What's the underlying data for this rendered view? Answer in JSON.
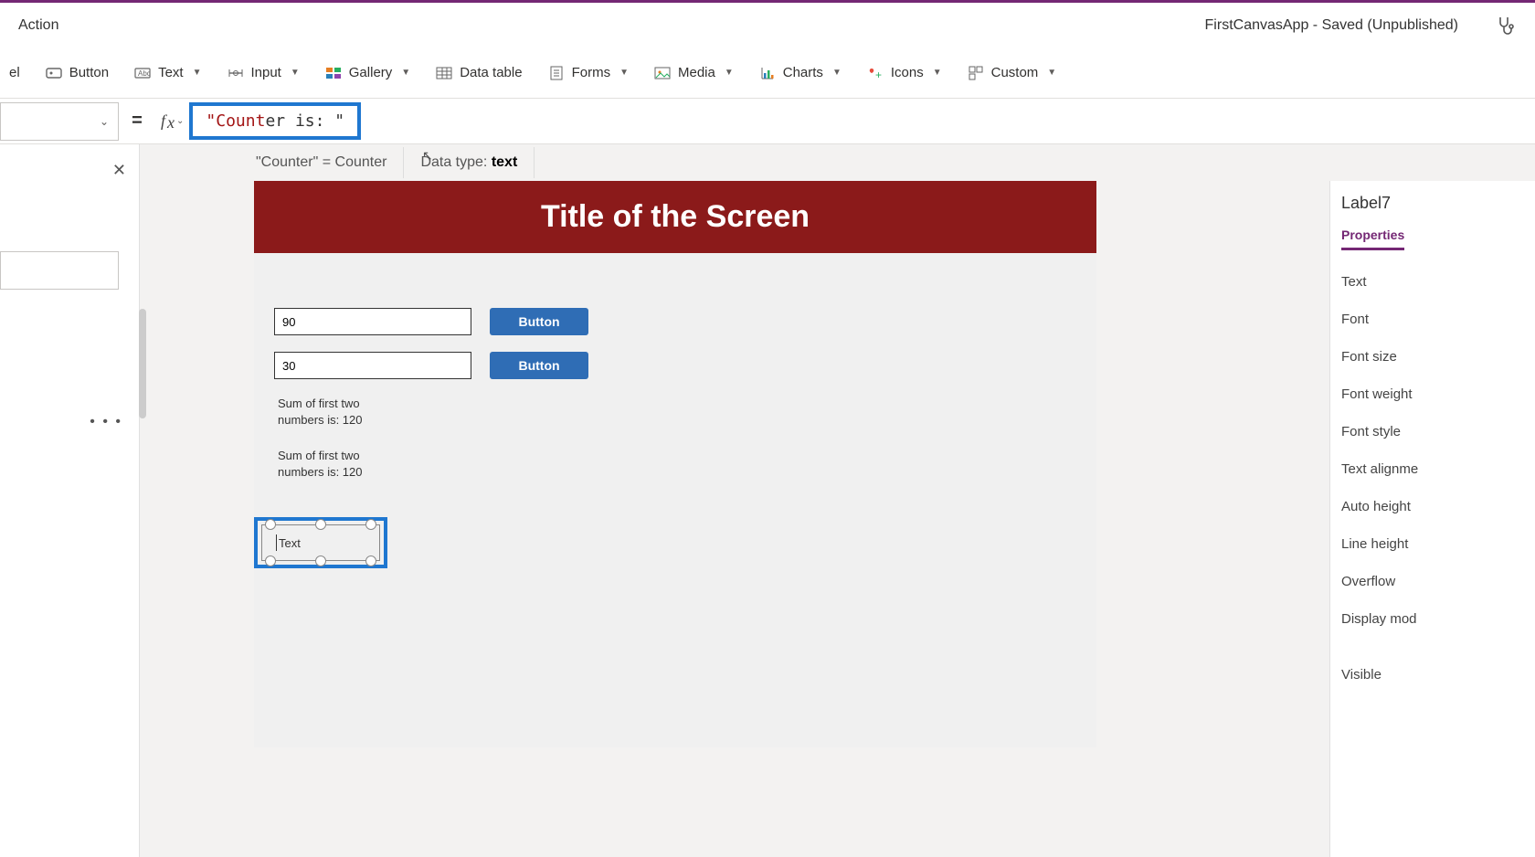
{
  "title_bar": {
    "menu_left": "Action",
    "app_title": "FirstCanvasApp - Saved (Unpublished)"
  },
  "ribbon": {
    "label_trunc": "el",
    "button": "Button",
    "text": "Text",
    "input": "Input",
    "gallery": "Gallery",
    "datatable": "Data table",
    "forms": "Forms",
    "media": "Media",
    "charts": "Charts",
    "icons": "Icons",
    "custom": "Custom"
  },
  "formula": {
    "value_quoted": "\"Counter is: \"",
    "value_highlight_prefix": "\"Count",
    "value_highlight_rest": "er is: \""
  },
  "intellisense": {
    "line": "\"Counter\"  =  Counter",
    "datatype_label": "Data type: ",
    "datatype_value": "text"
  },
  "canvas": {
    "screen_title": "Title of the Screen",
    "input1": "90",
    "input2": "30",
    "button_label": "Button",
    "sum1": "Sum of first two numbers is: 120",
    "sum2": "Sum of first two numbers is: 120",
    "selected_label_text": "Text"
  },
  "right": {
    "control_name": "Label7",
    "tab": "Properties",
    "props": [
      "Text",
      "Font",
      "Font size",
      "Font weight",
      "Font style",
      "Text alignme",
      "Auto height",
      "Line height",
      "Overflow",
      "Display mod",
      "Visible"
    ]
  }
}
